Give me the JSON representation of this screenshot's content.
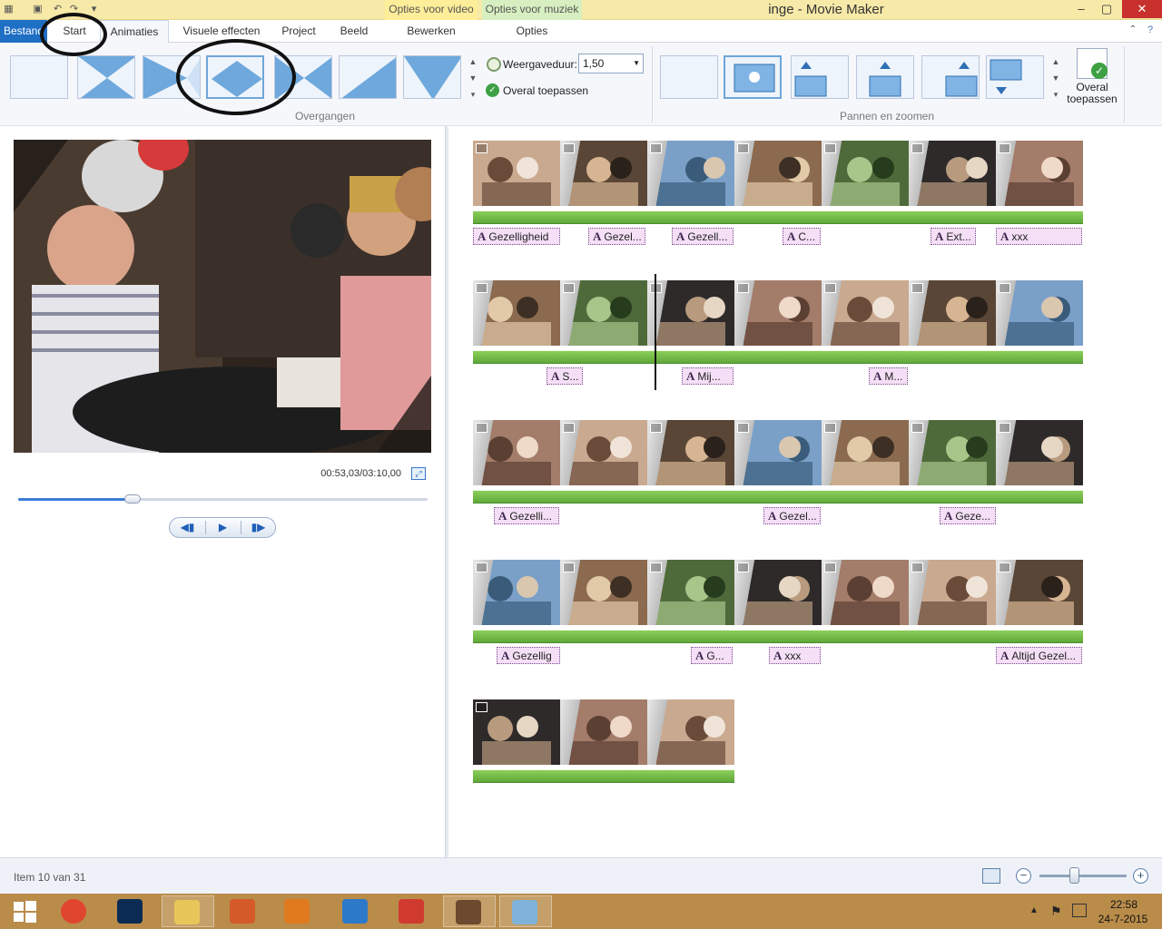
{
  "window": {
    "title": "inge - Movie Maker",
    "minimize": "–",
    "maximize": "▢",
    "close": "✕"
  },
  "contextual_tabs": {
    "video_header": "Opties voor video",
    "music_header": "Opties voor muziek"
  },
  "tabs": {
    "file": "Bestand",
    "start": "Start",
    "animations": "Animaties",
    "visual_effects": "Visuele effecten",
    "project": "Project",
    "view": "Beeld",
    "edit": "Bewerken",
    "options": "Opties"
  },
  "ribbon": {
    "transitions_group": "Overgangen",
    "duration_label": "Weergaveduur:",
    "duration_value": "1,50",
    "apply_all_transitions": "Overal toepassen",
    "pan_zoom_group": "Pannen en zoomen",
    "apply_all_pan_line1": "Overal",
    "apply_all_pan_line2": "toepassen",
    "transition_icons": [
      "no-transition",
      "cross-diamond-transition",
      "arrow-transition",
      "diamond-transition",
      "bowtie-transition",
      "diagonal-wipe-transition",
      "v-wipe-transition"
    ],
    "selected_transition_index": 3,
    "pan_icons": [
      "no-pan-zoom",
      "automatic-pan-zoom",
      "pan-up-left",
      "pan-up",
      "pan-up-right",
      "pan-down-left"
    ],
    "selected_pan_index": 1
  },
  "player": {
    "time": "00:53,03/03:10,00",
    "progress_fraction": 0.28
  },
  "storyboard": {
    "rows": [
      {
        "clips": 7,
        "captions": [
          {
            "text": "Gezelligheid",
            "start": 0,
            "width": 96
          },
          {
            "text": "Gezel...",
            "start": 127,
            "width": 63
          },
          {
            "text": "Gezell...",
            "start": 219,
            "width": 68
          },
          {
            "text": "C...",
            "start": 341,
            "width": 42
          },
          {
            "text": "Ext...",
            "start": 504,
            "width": 50
          },
          {
            "text": "xxx",
            "start": 576,
            "width": 95
          }
        ]
      },
      {
        "clips": 7,
        "captions": [
          {
            "text": "S...",
            "start": 81,
            "width": 40
          },
          {
            "text": "Mij...",
            "start": 230,
            "width": 57
          },
          {
            "text": "M...",
            "start": 436,
            "width": 43
          }
        ]
      },
      {
        "clips": 7,
        "captions": [
          {
            "text": "Gezelli...",
            "start": 23,
            "width": 72
          },
          {
            "text": "Gezel...",
            "start": 320,
            "width": 63
          },
          {
            "text": "Geze...",
            "start": 514,
            "width": 62
          }
        ]
      },
      {
        "clips": 7,
        "captions": [
          {
            "text": "Gezellig",
            "start": 26,
            "width": 70
          },
          {
            "text": "G...",
            "start": 240,
            "width": 46
          },
          {
            "text": "xxx",
            "start": 326,
            "width": 57
          },
          {
            "text": "Altijd Gezel...",
            "start": 576,
            "width": 95
          }
        ]
      },
      {
        "clips": 3,
        "captions": []
      }
    ]
  },
  "status": {
    "item_text": "Item 10 van 31",
    "zoom_fraction": 0.4
  },
  "taskbar": {
    "apps": [
      "windows-start",
      "chrome",
      "photoshop",
      "file-explorer",
      "gallery",
      "video-player",
      "live-mail",
      "app-grid",
      "movie-maker",
      "paint"
    ],
    "time": "22:58",
    "date": "24-7-2015"
  }
}
